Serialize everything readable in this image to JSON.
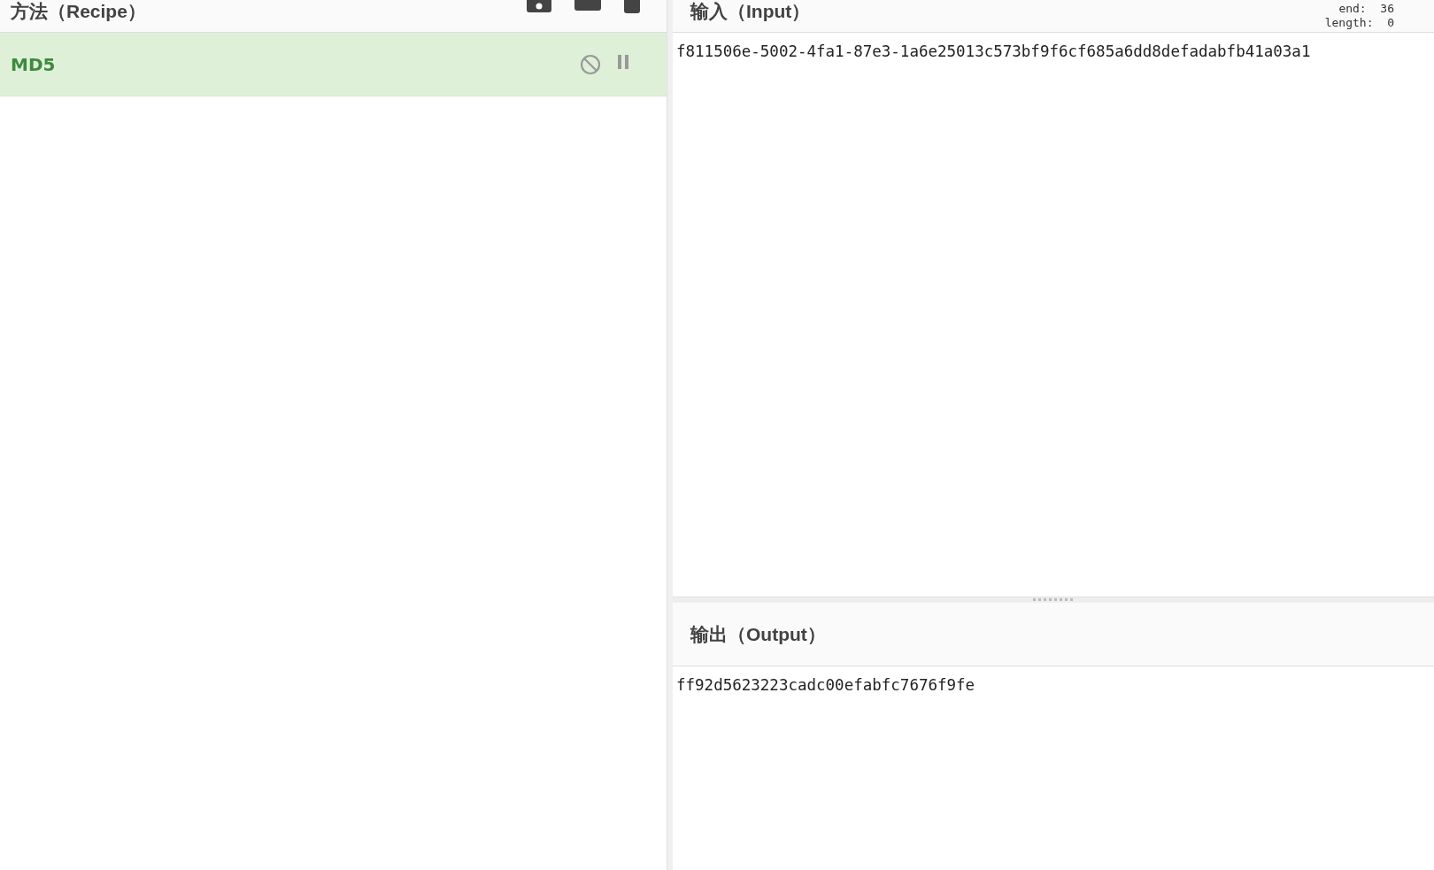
{
  "recipe": {
    "title": "方法（Recipe）",
    "operations": [
      {
        "name": "MD5",
        "disabled": false,
        "paused": false
      }
    ]
  },
  "input": {
    "title": "输入（Input）",
    "stats": [
      {
        "label": "end:",
        "value": "36"
      },
      {
        "label": "length:",
        "value": "0"
      }
    ],
    "value": "f811506e-5002-4fa1-87e3-1a6e25013c573bf9f6cf685a6dd8defadabfb41a03a1"
  },
  "output": {
    "title": "输出（Output）",
    "value": "ff92d5623223cadc00efabfc7676f9fe"
  }
}
